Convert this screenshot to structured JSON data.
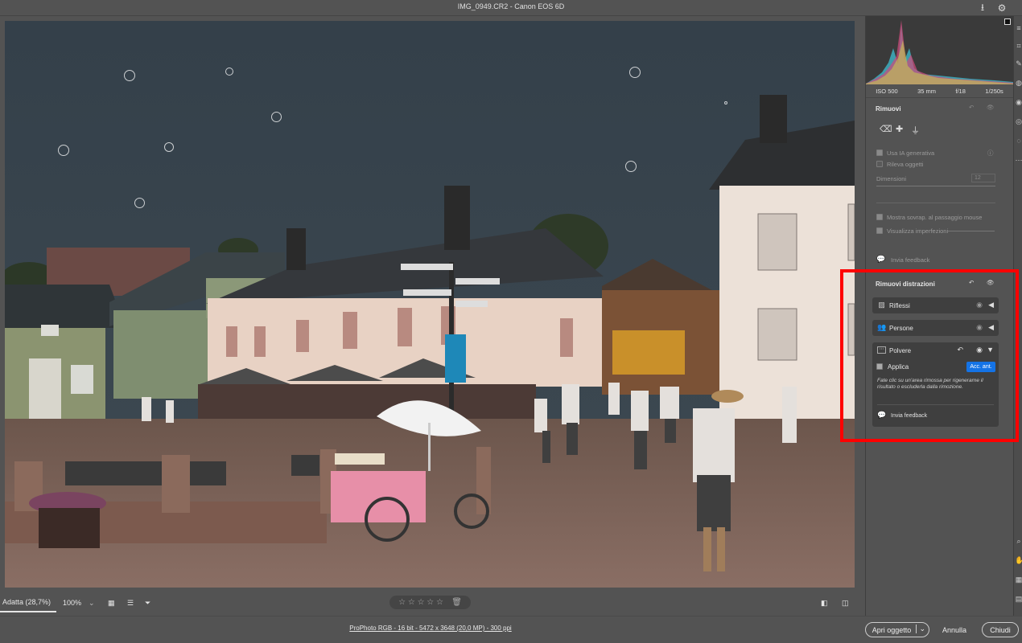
{
  "window": {
    "title": "IMG_0949.CR2  -  Canon EOS 6D"
  },
  "histogram": {
    "exif": [
      "ISO 500",
      "35 mm",
      "f/18",
      "1/250s"
    ]
  },
  "remove_panel": {
    "title": "Rimuovi",
    "use_ai": "Usa IA generativa",
    "detect_objects": "Rileva oggetti",
    "size_label": "Dimensioni",
    "size_value": "12",
    "show_overlay": "Mostra sovrap. al passaggio mouse",
    "show_imperfections": "Visualizza imperfezioni",
    "feedback": "Invia feedback"
  },
  "distractions_panel": {
    "title": "Rimuovi distrazioni",
    "items": [
      {
        "label": "Riflessi"
      },
      {
        "label": "Persone"
      },
      {
        "label": "Polvere"
      }
    ],
    "apply_label": "Applica",
    "apply_button": "Acc. ant.",
    "help_text": "Fate clic su un'area rimossa per rigenerarne il risultato o escluderla dalla rimozione.",
    "feedback": "Invia feedback"
  },
  "bottom_toolbar": {
    "zoom_fit": "Adatta (28,7%)",
    "zoom_100": "100%",
    "stars": "☆ ☆ ☆ ☆ ☆"
  },
  "status": {
    "workflow": "ProPhoto RGB - 16 bit - 5472 x 3648 (20,0 MP) - 300 ppi",
    "open_button": "Apri oggetto",
    "cancel": "Annulla",
    "close": "Chiudi"
  },
  "colors": {
    "highlight": "#ff0000",
    "accent_button": "#1473e6",
    "panel_bg": "#535353"
  }
}
